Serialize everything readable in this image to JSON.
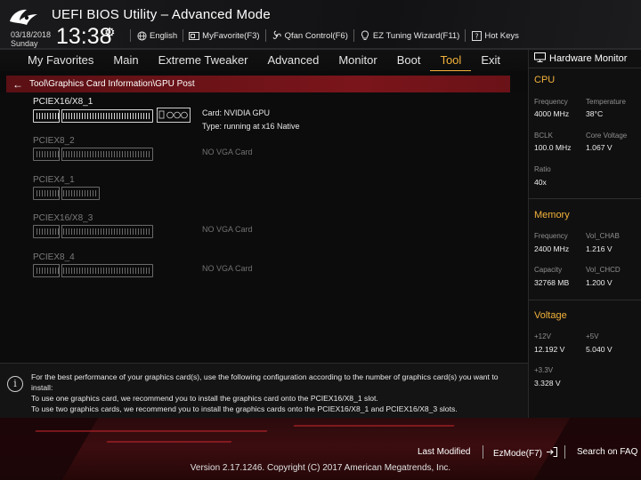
{
  "header": {
    "app_title": "UEFI BIOS Utility – Advanced Mode",
    "date": "03/18/2018",
    "day": "Sunday",
    "time": "13:38",
    "toolbar": [
      {
        "label": "English",
        "icon": "globe-icon"
      },
      {
        "label": "MyFavorite(F3)",
        "icon": "favorite-icon"
      },
      {
        "label": "Qfan Control(F6)",
        "icon": "fan-icon"
      },
      {
        "label": "EZ Tuning Wizard(F11)",
        "icon": "bulb-icon"
      },
      {
        "label": "Hot Keys",
        "icon": "question-icon"
      }
    ]
  },
  "menu": {
    "items": [
      "My Favorites",
      "Main",
      "Extreme Tweaker",
      "Advanced",
      "Monitor",
      "Boot",
      "Tool",
      "Exit"
    ],
    "active": "Tool"
  },
  "breadcrumb": "Tool\\Graphics Card Information\\GPU Post",
  "slots": [
    {
      "name": "PCIEX16/X8_1",
      "card": "Card: NVIDIA GPU",
      "type": "Type: running at x16 Native",
      "populated": true
    },
    {
      "name": "PCIEX8_2",
      "status": "NO VGA Card",
      "populated": false
    },
    {
      "name": "PCIEX4_1",
      "status": "",
      "populated": false
    },
    {
      "name": "PCIEX16/X8_3",
      "status": "NO VGA Card",
      "populated": false
    },
    {
      "name": "PCIEX8_4",
      "status": "NO VGA Card",
      "populated": false
    }
  ],
  "info": {
    "line1": "For the best performance of your graphics card(s), use the following configuration according to the number of graphics card(s) you want to install:",
    "line2": "To use one graphics card, we recommend you to install  the graphics card onto the PCIEX16/X8_1 slot.",
    "line3": "To use two graphics cards, we recommend you to install the graphics cards onto the PCIEX16/X8_1 and PCIEX16/X8_3 slots."
  },
  "hardware_monitor": {
    "title": "Hardware Monitor",
    "cpu": {
      "title": "CPU",
      "frequency_label": "Frequency",
      "frequency": "4000 MHz",
      "temperature_label": "Temperature",
      "temperature": "38°C",
      "bclk_label": "BCLK",
      "bclk": "100.0 MHz",
      "core_voltage_label": "Core Voltage",
      "core_voltage": "1.067 V",
      "ratio_label": "Ratio",
      "ratio": "40x"
    },
    "memory": {
      "title": "Memory",
      "frequency_label": "Frequency",
      "frequency": "2400 MHz",
      "vol_chab_label": "Vol_CHAB",
      "vol_chab": "1.216 V",
      "capacity_label": "Capacity",
      "capacity": "32768 MB",
      "vol_chcd_label": "Vol_CHCD",
      "vol_chcd": "1.200 V"
    },
    "voltage": {
      "title": "Voltage",
      "v12_label": "+12V",
      "v12": "12.192 V",
      "v5_label": "+5V",
      "v5": "5.040 V",
      "v33_label": "+3.3V",
      "v33": "3.328 V"
    }
  },
  "footer": {
    "last_modified": "Last Modified",
    "ezmode": "EzMode(F7)",
    "search": "Search on FAQ",
    "version": "Version 2.17.1246. Copyright (C) 2017 American Megatrends, Inc."
  },
  "colors": {
    "accent": "#f3b23a",
    "breadcrumb_red": "#7a151b"
  }
}
